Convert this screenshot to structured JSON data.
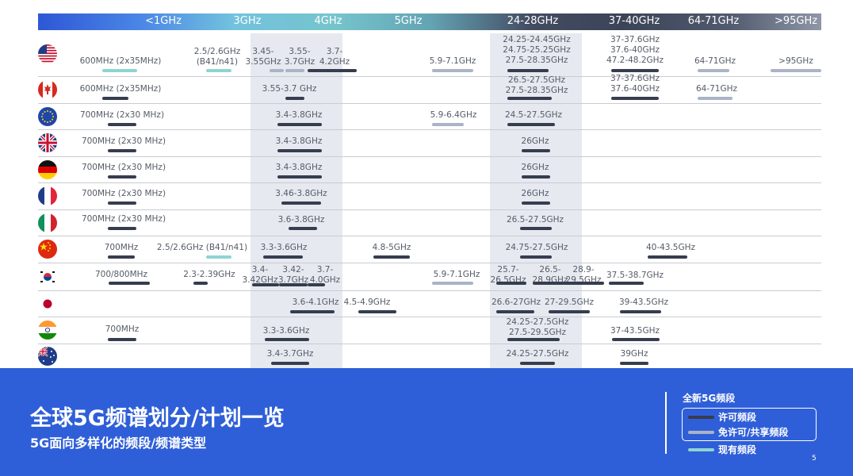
{
  "colors": {
    "licensed": "#363d4e",
    "unlicensed": "#aab3c7",
    "existing": "#8fd3d4",
    "footer_bg": "#2f5fd8",
    "header_gradient": [
      "#2e57d6",
      "#4a86e6",
      "#73c2de",
      "#75c4cc",
      "#64a4b4",
      "#434b62",
      "#3c4458",
      "#51596e",
      "#8e96a8"
    ]
  },
  "header_bands": [
    "<1GHz",
    "3GHz",
    "4GHz",
    "5GHz",
    "24-28GHz",
    "37-40GHz",
    "64-71GHz",
    ">95GHz"
  ],
  "countries": [
    {
      "name": "usa-flag-icon",
      "flag": "us"
    },
    {
      "name": "canada-flag-icon",
      "flag": "ca"
    },
    {
      "name": "eu-flag-icon",
      "flag": "eu"
    },
    {
      "name": "uk-flag-icon",
      "flag": "uk"
    },
    {
      "name": "germany-flag-icon",
      "flag": "de"
    },
    {
      "name": "france-flag-icon",
      "flag": "fr"
    },
    {
      "name": "italy-flag-icon",
      "flag": "it"
    },
    {
      "name": "china-flag-icon",
      "flag": "cn"
    },
    {
      "name": "korea-flag-icon",
      "flag": "kr"
    },
    {
      "name": "japan-flag-icon",
      "flag": "jp"
    },
    {
      "name": "india-flag-icon",
      "flag": "in"
    },
    {
      "name": "australia-flag-icon",
      "flag": "au"
    }
  ],
  "rows": [
    [
      {
        "text": [
          "600MHz (2x35MHz)"
        ],
        "type": "existing"
      },
      {
        "text": [
          "2.5/2.6GHz",
          "(B41/n41)"
        ],
        "type": "existing"
      },
      {
        "text": [
          "3.45-",
          "3.55GHz"
        ],
        "type": "unlicensed"
      },
      {
        "text": [
          "3.55-",
          "3.7GHz"
        ],
        "type": "unlicensed"
      },
      {
        "text": [
          "3.7-",
          "4.2GHz"
        ],
        "type": "licensed"
      },
      {
        "text": [
          "5.9-7.1GHz"
        ],
        "type": "unlicensed"
      },
      {
        "text": [
          "24.25-24.45GHz",
          "24.75-25.25GHz",
          "27.5-28.35GHz"
        ],
        "type": "licensed"
      },
      {
        "text": [
          "37-37.6GHz",
          "37.6-40GHz",
          "47.2-48.2GHz"
        ],
        "type": "licensed"
      },
      {
        "text": [
          "64-71GHz"
        ],
        "type": "unlicensed"
      },
      {
        "text": [
          ">95GHz"
        ],
        "type": "unlicensed"
      }
    ],
    [
      {
        "text": [
          "600MHz (2x35MHz)"
        ],
        "type": "licensed"
      },
      {
        "text": [
          "3.55-3.7 GHz"
        ],
        "type": "licensed"
      },
      {
        "text": [
          "26.5-27.5GHz",
          "27.5-28.35GHz"
        ],
        "type": "licensed"
      },
      {
        "text": [
          "37-37.6GHz",
          "37.6-40GHz"
        ],
        "type": "licensed"
      },
      {
        "text": [
          "64-71GHz"
        ],
        "type": "unlicensed"
      }
    ],
    [
      {
        "text": [
          "700MHz (2x30 MHz)"
        ],
        "type": "licensed"
      },
      {
        "text": [
          "3.4-3.8GHz"
        ],
        "type": "licensed"
      },
      {
        "text": [
          "5.9-6.4GHz"
        ],
        "type": "unlicensed"
      },
      {
        "text": [
          "24.5-27.5GHz"
        ],
        "type": "licensed"
      }
    ],
    [
      {
        "text": [
          "700MHz (2x30 MHz)"
        ],
        "type": "licensed"
      },
      {
        "text": [
          "3.4-3.8GHz"
        ],
        "type": "licensed"
      },
      {
        "text": [
          "26GHz"
        ],
        "type": "licensed"
      }
    ],
    [
      {
        "text": [
          "700MHz (2x30 MHz)"
        ],
        "type": "licensed"
      },
      {
        "text": [
          "3.4-3.8GHz"
        ],
        "type": "licensed"
      },
      {
        "text": [
          "26GHz"
        ],
        "type": "licensed"
      }
    ],
    [
      {
        "text": [
          "700MHz (2x30 MHz)"
        ],
        "type": "licensed"
      },
      {
        "text": [
          "3.46-3.8GHz"
        ],
        "type": "licensed"
      },
      {
        "text": [
          "26GHz"
        ],
        "type": "licensed"
      }
    ],
    [
      {
        "text": [
          "700MHz (2x30 MHz)"
        ],
        "type": "licensed"
      },
      {
        "text": [
          "3.6-3.8GHz"
        ],
        "type": "licensed"
      },
      {
        "text": [
          "26.5-27.5GHz"
        ],
        "type": "licensed"
      }
    ],
    [
      {
        "text": [
          "700MHz"
        ],
        "type": "licensed"
      },
      {
        "text": [
          "2.5/2.6GHz (B41/n41)"
        ],
        "type": "existing"
      },
      {
        "text": [
          "3.3-3.6GHz"
        ],
        "type": "licensed"
      },
      {
        "text": [
          "4.8-5GHz"
        ],
        "type": "licensed"
      },
      {
        "text": [
          "24.75-27.5GHz"
        ],
        "type": "licensed"
      },
      {
        "text": [
          "40-43.5GHz"
        ],
        "type": "licensed"
      }
    ],
    [
      {
        "text": [
          "700/800MHz"
        ],
        "type": "licensed"
      },
      {
        "text": [
          "2.3-2.39GHz"
        ],
        "type": "licensed"
      },
      {
        "text": [
          "3.4-",
          "3.42GHz"
        ],
        "type": "licensed"
      },
      {
        "text": [
          "3.42-",
          "3.7GHz"
        ],
        "type": "licensed"
      },
      {
        "text": [
          "3.7-",
          "4.0GHz"
        ],
        "type": "licensed"
      },
      {
        "text": [
          "5.9-7.1GHz"
        ],
        "type": "unlicensed"
      },
      {
        "text": [
          "25.7-",
          "26.5GHz"
        ],
        "type": "licensed"
      },
      {
        "text": [
          "26.5-",
          "28.9GHz"
        ],
        "type": "licensed"
      },
      {
        "text": [
          "28.9-",
          "29.5GHz"
        ],
        "type": "licensed"
      },
      {
        "text": [
          "37.5-38.7GHz"
        ],
        "type": "licensed"
      }
    ],
    [
      {
        "text": [
          "3.6-4.1GHz"
        ],
        "type": "licensed"
      },
      {
        "text": [
          "4.5-4.9GHz"
        ],
        "type": "licensed"
      },
      {
        "text": [
          "26.6-27GHz"
        ],
        "type": "licensed"
      },
      {
        "text": [
          "27-29.5GHz"
        ],
        "type": "licensed"
      },
      {
        "text": [
          "39-43.5GHz"
        ],
        "type": "licensed"
      }
    ],
    [
      {
        "text": [
          "700MHz"
        ],
        "type": "licensed"
      },
      {
        "text": [
          "3.3-3.6GHz"
        ],
        "type": "licensed"
      },
      {
        "text": [
          "24.25-27.5GHz",
          "27.5-29.5GHz"
        ],
        "type": "licensed"
      },
      {
        "text": [
          "37-43.5GHz"
        ],
        "type": "licensed"
      }
    ],
    [
      {
        "text": [
          "3.4-3.7GHz"
        ],
        "type": "licensed"
      },
      {
        "text": [
          "24.25-27.5GHz"
        ],
        "type": "licensed"
      },
      {
        "text": [
          "39GHz"
        ],
        "type": "licensed"
      }
    ]
  ],
  "footer": {
    "title": "全球5G频谱划分/计划一览",
    "subtitle": "5G面向多样化的频段/频谱类型",
    "page_number": "5"
  },
  "legend": {
    "title": "全新5G频段",
    "items": [
      {
        "label": "许可频段",
        "type": "licensed"
      },
      {
        "label": "免许可/共享频段",
        "type": "unlicensed"
      },
      {
        "label": "现有频段",
        "type": "existing"
      }
    ]
  }
}
